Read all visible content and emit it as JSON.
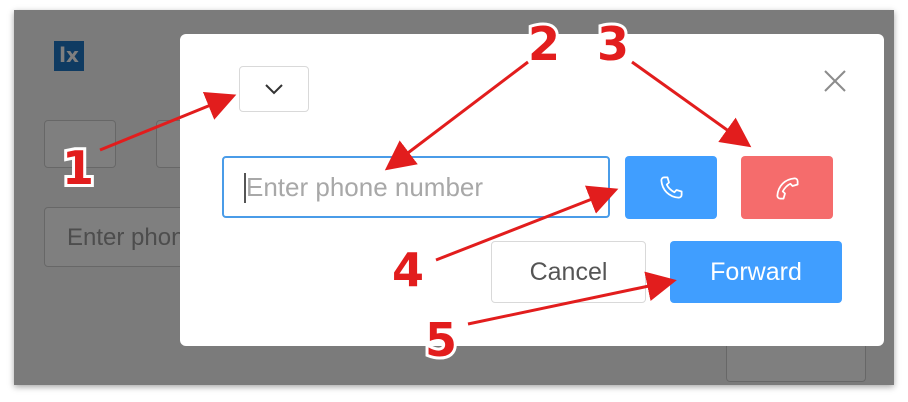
{
  "background": {
    "logo_text": "lx",
    "input_placeholder": "Enter phone number"
  },
  "dialog": {
    "phone_input_placeholder": "Enter phone number",
    "cancel_label": "Cancel",
    "forward_label": "Forward",
    "call_icon": "phone-icon",
    "hangup_icon": "phone-hangup-icon",
    "close_icon": "close-icon",
    "dropdown_icon": "chevron-down-icon"
  },
  "annotations": [
    "1",
    "2",
    "3",
    "4",
    "5"
  ],
  "colors": {
    "primary": "#409eff",
    "danger": "#f56c6c",
    "annotation": "#e21d1d",
    "overlay": "rgba(0,0,0,0.5)"
  }
}
